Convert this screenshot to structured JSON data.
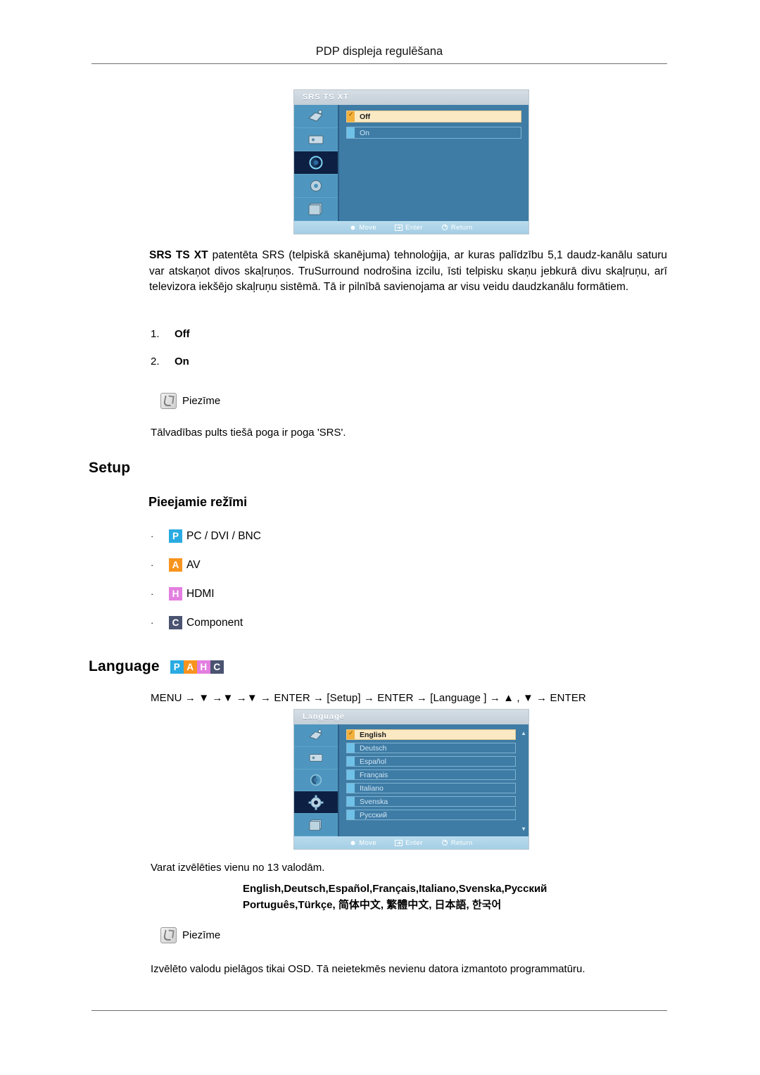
{
  "header": {
    "title": "PDP displeja regulēšana"
  },
  "osd_srs": {
    "title": "SRS TS XT",
    "sidebar_icons": [
      "picture-icon",
      "input-icon",
      "sound-icon",
      "setup-icon",
      "multi-control-icon"
    ],
    "active_index": 2,
    "rows": [
      {
        "label": "Off",
        "selected": true
      },
      {
        "label": "On",
        "selected": false
      }
    ],
    "footer": {
      "move": "Move",
      "enter": "Enter",
      "return": "Return"
    }
  },
  "srs_paragraph": {
    "lead": "SRS TS XT",
    "body": " patentēta SRS (telpiskā skanējuma) tehnoloģija, ar kuras palīdzību 5,1 daudz-kanālu saturu var atskaņot divos skaļruņos. TruSurround nodrošina izcilu, īsti telpisku skaņu jebkurā divu skaļruņu, arī televizora iekšējo skaļruņu sistēmā. Tā ir pilnībā savienojama ar visu veidu daudzkanālu formātiem."
  },
  "srs_options": [
    {
      "num": "1.",
      "label": "Off"
    },
    {
      "num": "2.",
      "label": "On"
    }
  ],
  "note1": {
    "label": "Piezīme",
    "text": "Tālvadības pults tiešā poga ir poga 'SRS'."
  },
  "setup_section": {
    "heading": "Setup",
    "subheading": "Pieejamie režīmi",
    "modes": [
      {
        "badge": "P",
        "color": "#29ABE2",
        "label": "PC / DVI / BNC"
      },
      {
        "badge": "A",
        "color": "#F7941E",
        "label": "AV"
      },
      {
        "badge": "H",
        "color": "#E37FE0",
        "label": "HDMI"
      },
      {
        "badge": "C",
        "color": "#4A5370",
        "label": "Component"
      }
    ]
  },
  "language_section": {
    "heading": "Language",
    "badges": [
      {
        "badge": "P",
        "color": "#29ABE2"
      },
      {
        "badge": "A",
        "color": "#F7941E"
      },
      {
        "badge": "H",
        "color": "#E37FE0"
      },
      {
        "badge": "C",
        "color": "#4A5370"
      }
    ],
    "nav_path": "MENU → ▼ →▼ →▼ → ENTER → [Setup] → ENTER → [Language ] → ▲ , ▼ → ENTER",
    "osd": {
      "title": "Language",
      "sidebar_icons": [
        "picture-icon",
        "input-icon",
        "sound-icon",
        "setup-icon",
        "multi-control-icon"
      ],
      "active_index": 3,
      "rows": [
        {
          "label": "English",
          "selected": true
        },
        {
          "label": "Deutsch",
          "selected": false
        },
        {
          "label": "Español",
          "selected": false
        },
        {
          "label": "Français",
          "selected": false
        },
        {
          "label": "Italiano",
          "selected": false
        },
        {
          "label": "Svenska",
          "selected": false
        },
        {
          "label": "Русский",
          "selected": false
        }
      ],
      "scroll_up": "▲",
      "scroll_down": "▼",
      "footer": {
        "move": "Move",
        "enter": "Enter",
        "return": "Return"
      }
    },
    "caption": "Varat izvēlēties vienu no 13 valodām.",
    "list_line1": "English,Deutsch,Español,Français,Italiano,Svenska,Русский",
    "list_line2": "Português,Türkçe, 简体中文,  繁體中文, 日本語, 한국어"
  },
  "note2": {
    "label": "Piezīme",
    "text": "Izvēlēto valodu pielāgos tikai OSD. Tā neietekmēs nevienu datora izmantoto programmatūru."
  }
}
